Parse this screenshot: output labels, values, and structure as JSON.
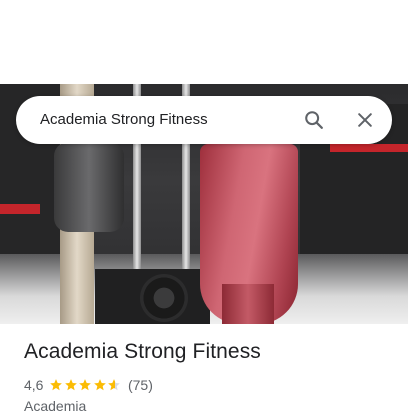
{
  "search": {
    "query": "Academia Strong Fitness",
    "search_icon": "search-icon",
    "close_icon": "close-icon"
  },
  "place": {
    "name": "Academia Strong Fitness",
    "rating": "4,6",
    "rating_value": 4.6,
    "reviews": "(75)",
    "category": "Academia"
  },
  "colors": {
    "star": "#fbbc04",
    "text_primary": "#202124",
    "text_secondary": "#5f6368"
  }
}
